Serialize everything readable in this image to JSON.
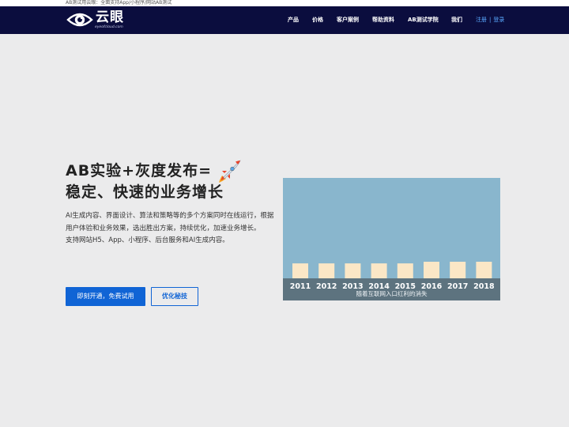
{
  "page": {
    "top_text": "AB测试用云眼：全面支持App/小程序/网站AB测试"
  },
  "logo": {
    "text": "云眼",
    "subtext": "eyeofcloud.com"
  },
  "nav": {
    "items": [
      {
        "label": "产品"
      },
      {
        "label": "价格"
      },
      {
        "label": "客户案例"
      },
      {
        "label": "帮助资料"
      },
      {
        "label": "AB测试学院"
      },
      {
        "label": "我们"
      }
    ],
    "register": "注册",
    "separator": "|",
    "login": "登录"
  },
  "hero": {
    "title_line1": "AB实验+灰度发布=",
    "title_line2": "稳定、快速的业务增长",
    "rocket_icon": "rocket-icon",
    "desc_line1": "AI生成内容、界面设计、算法和策略等的多个方案同时在线运行，根据用户体验和业务效果，选出胜出方案，持续优化，加速业务增长。",
    "desc_line2": "支持网站H5、App、小程序、后台服务和AI生成内容。",
    "primary_button": "即刻开通，免费试用",
    "secondary_button": "优化秘技"
  },
  "chart_data": {
    "type": "bar",
    "categories": [
      "2011",
      "2012",
      "2013",
      "2014",
      "2015",
      "2016",
      "2017",
      "2018"
    ],
    "values": [
      0.9,
      0.9,
      0.9,
      0.9,
      0.9,
      1.0,
      1.0,
      1.0
    ],
    "caption": "随着互联网入口红利的消失",
    "colors": {
      "background": "#89b6cd",
      "bar": "#fbe7c6",
      "band": "#5d737f",
      "label": "#ffffff"
    }
  }
}
